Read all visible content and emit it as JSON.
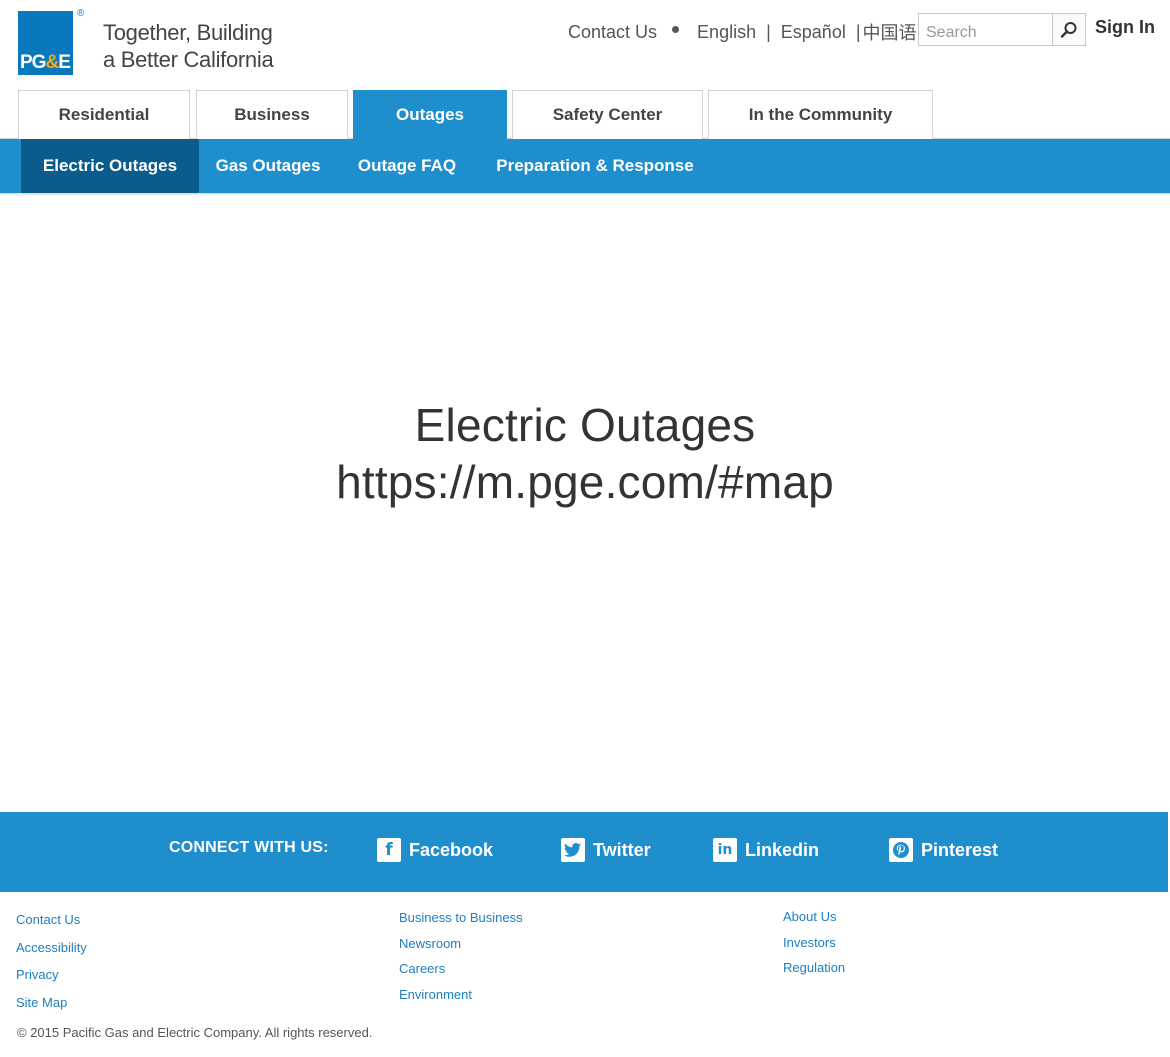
{
  "brand": {
    "logo_text_a": "PG",
    "logo_text_amp": "&",
    "logo_text_b": "E",
    "logo_reg": "®",
    "tagline_line1": "Together, Building",
    "tagline_line2": "a Better California"
  },
  "utility": {
    "contact_label": "Contact Us",
    "lang_english": "English",
    "separator": "|",
    "lang_espanol": "Español",
    "lang_chinese": "中国语",
    "search_placeholder": "Search",
    "signin_label": "Sign In"
  },
  "tabs": [
    {
      "label": "Residential",
      "active": false
    },
    {
      "label": "Business",
      "active": false
    },
    {
      "label": "Outages",
      "active": true
    },
    {
      "label": "Safety Center",
      "active": false
    },
    {
      "label": "In the Community",
      "active": false
    }
  ],
  "subnav": [
    {
      "label": "Electric Outages",
      "active": true
    },
    {
      "label": "Gas Outages",
      "active": false
    },
    {
      "label": "Outage FAQ",
      "active": false
    },
    {
      "label": "Preparation & Response",
      "active": false
    }
  ],
  "main": {
    "title": "Electric Outages",
    "url": "https://m.pge.com/#map"
  },
  "social": {
    "lead": "CONNECT WITH US:",
    "items": [
      {
        "label": "Facebook",
        "icon": "facebook-icon"
      },
      {
        "label": "Twitter",
        "icon": "twitter-icon"
      },
      {
        "label": "Linkedin",
        "icon": "linkedin-icon"
      },
      {
        "label": "Pinterest",
        "icon": "pinterest-icon"
      }
    ]
  },
  "footer": {
    "col1": [
      "Contact Us",
      "Accessibility",
      "Privacy",
      "Site Map"
    ],
    "col2": [
      "Business to Business",
      "Newsroom",
      "Careers",
      "Environment"
    ],
    "col3": [
      "About Us",
      "Investors",
      "Regulation"
    ],
    "copyright": "© 2015  Pacific Gas and Electric Company. All rights reserved."
  },
  "colors": {
    "primary_blue": "#1f8ecd",
    "active_dark_blue": "#0b5b8c",
    "link_blue": "#1f7ec0",
    "logo_orange": "#f5a623"
  }
}
